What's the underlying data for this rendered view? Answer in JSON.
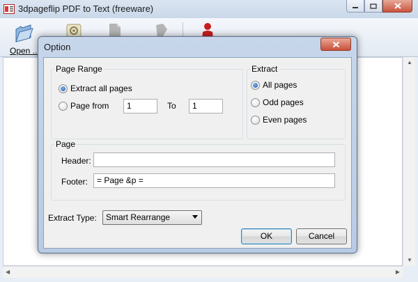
{
  "app": {
    "title": "3dpageflip PDF to Text (freeware)",
    "toolbar": {
      "open_label": "Open ..."
    }
  },
  "dialog": {
    "title": "Option",
    "page_range": {
      "legend": "Page Range",
      "extract_all_label": "Extract all pages",
      "extract_all_selected": true,
      "page_from_label": "Page from",
      "from_value": "1",
      "to_label": "To",
      "to_value": "1"
    },
    "extract": {
      "legend": "Extract",
      "options": [
        {
          "label": "All pages",
          "selected": true
        },
        {
          "label": "Odd pages",
          "selected": false
        },
        {
          "label": "Even pages",
          "selected": false
        }
      ]
    },
    "page": {
      "legend": "Page",
      "header_label": "Header:",
      "header_value": "",
      "footer_label": "Footer:",
      "footer_value": "= Page &p ="
    },
    "extract_type": {
      "label": "Extract Type:",
      "selected": "Smart Rearrange"
    },
    "buttons": {
      "ok_label": "OK",
      "cancel_label": "Cancel"
    }
  },
  "colors": {
    "dialog_frame": "#b9cbe3",
    "close_red": "#c9503a",
    "radio_selected": "#1f5fb0"
  }
}
